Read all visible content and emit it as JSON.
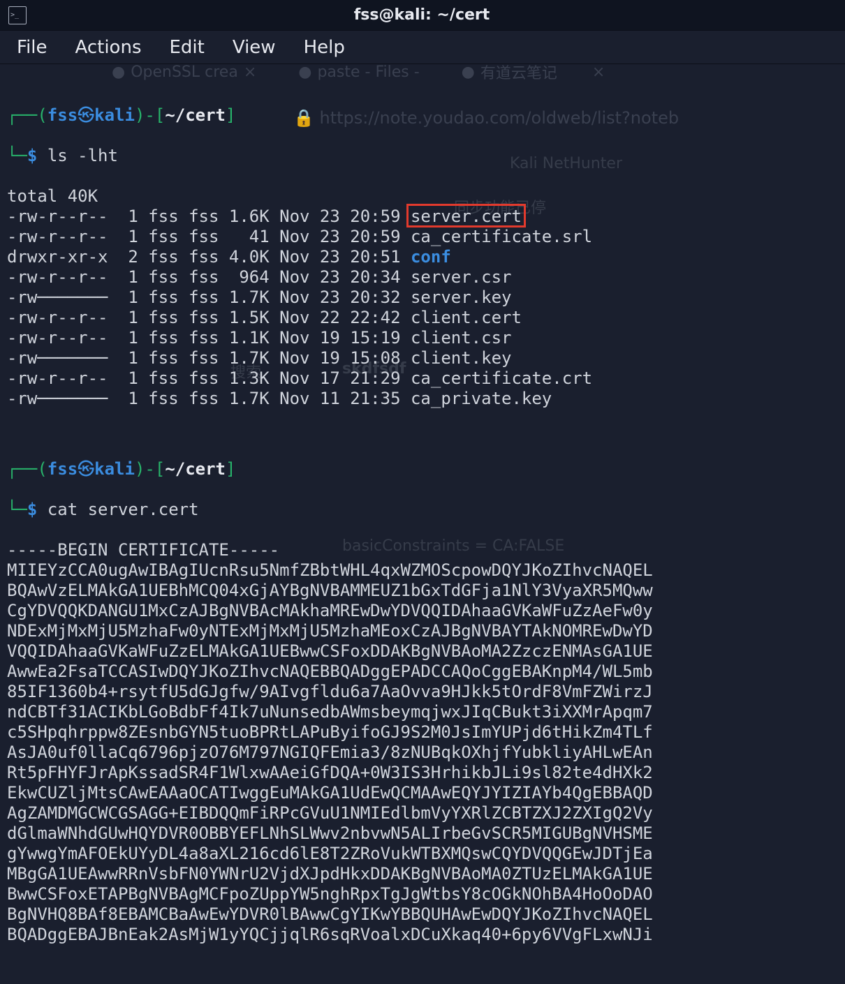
{
  "titlebar": {
    "title": "fss@kali: ~/cert"
  },
  "menubar": {
    "file": "File",
    "actions": "Actions",
    "edit": "Edit",
    "view": "View",
    "help": "Help"
  },
  "ghost": {
    "tab1": "OpenSSL crea",
    "tab2": "paste - Files -",
    "tab3": "有道云笔记",
    "url": "https://note.youdao.com/oldweb/list?noteb",
    "right1": "同步功能已停",
    "search": "搜索",
    "skdf": "skdfsdf",
    "basic": "basicConstraints = CA:FALSE",
    "netHunter": "Kali NetHunter"
  },
  "prompt": {
    "user": "fss",
    "host": "kali",
    "path": "~/cert",
    "cmd1": "ls -lht",
    "cmd2": "cat server.cert"
  },
  "ls": {
    "total": "total 40K",
    "rows": [
      {
        "perm": "-rw-r--r--",
        "ln": "1",
        "u": "fss",
        "g": "fss",
        "sz": "1.6K",
        "dt": "Nov 23 20:59",
        "name": "server.cert",
        "dir": false
      },
      {
        "perm": "-rw-r--r--",
        "ln": "1",
        "u": "fss",
        "g": "fss",
        "sz": "  41",
        "dt": "Nov 23 20:59",
        "name": "ca_certificate.srl",
        "dir": false
      },
      {
        "perm": "drwxr-xr-x",
        "ln": "2",
        "u": "fss",
        "g": "fss",
        "sz": "4.0K",
        "dt": "Nov 23 20:51",
        "name": "conf",
        "dir": true
      },
      {
        "perm": "-rw-r--r--",
        "ln": "1",
        "u": "fss",
        "g": "fss",
        "sz": " 964",
        "dt": "Nov 23 20:34",
        "name": "server.csr",
        "dir": false
      },
      {
        "perm": "-rw-------",
        "ln": "1",
        "u": "fss",
        "g": "fss",
        "sz": "1.7K",
        "dt": "Nov 23 20:32",
        "name": "server.key",
        "dir": false
      },
      {
        "perm": "-rw-r--r--",
        "ln": "1",
        "u": "fss",
        "g": "fss",
        "sz": "1.5K",
        "dt": "Nov 22 22:42",
        "name": "client.cert",
        "dir": false
      },
      {
        "perm": "-rw-r--r--",
        "ln": "1",
        "u": "fss",
        "g": "fss",
        "sz": "1.1K",
        "dt": "Nov 19 15:19",
        "name": "client.csr",
        "dir": false
      },
      {
        "perm": "-rw-------",
        "ln": "1",
        "u": "fss",
        "g": "fss",
        "sz": "1.7K",
        "dt": "Nov 19 15:08",
        "name": "client.key",
        "dir": false
      },
      {
        "perm": "-rw-r--r--",
        "ln": "1",
        "u": "fss",
        "g": "fss",
        "sz": "1.3K",
        "dt": "Nov 17 21:29",
        "name": "ca_certificate.crt",
        "dir": false
      },
      {
        "perm": "-rw-------",
        "ln": "1",
        "u": "fss",
        "g": "fss",
        "sz": "1.7K",
        "dt": "Nov 11 21:35",
        "name": "ca_private.key",
        "dir": false
      }
    ]
  },
  "cert": {
    "begin": "-----BEGIN CERTIFICATE-----",
    "lines": [
      "MIIEYzCCA0ugAwIBAgIUcnRsu5NmfZBbtWHL4qxWZMOScpowDQYJKoZIhvcNAQEL",
      "BQAwVzELMAkGA1UEBhMCQ04xGjAYBgNVBAMMEUZ1bGxTdGFja1NlY3VyaXR5MQww",
      "CgYDVQQKDANGU1MxCzAJBgNVBAcMAkhaMREwDwYDVQQIDAhaaGVKaWFuZzAeFw0y",
      "NDExMjMxMjU5MzhaFw0yNTExMjMxMjU5MzhaMEoxCzAJBgNVBAYTAkNOMREwDwYD",
      "VQQIDAhaaGVKaWFuZzELMAkGA1UEBwwCSFoxDDAKBgNVBAoMA2ZzczENMAsGA1UE",
      "AwwEa2FsaTCCASIwDQYJKoZIhvcNAQEBBQADggEPADCCAQoCggEBAKnpM4/WL5mb",
      "85IF1360b4+rsytfU5dGJgfw/9AIvgfldu6a7AaOvva9HJkk5tOrdF8VmFZWirzJ",
      "ndCBTf31ACIKbLGoBdbFf4Ik7uNunsedbAWmsbeymqjwxJIqCBukt3iXXMrApqm7",
      "c5SHpqhrppw8ZEsnbGYN5tuoBPRtLAPuByifoGJ9S2M0JsImYUPjd6tHikZm4TLf",
      "AsJA0uf0llaCq6796pjzO76M797NGIQFEmia3/8zNUBqkOXhjfYubkliyAHLwEAn",
      "Rt5pFHYFJrApKssadSR4F1WlxwAAeiGfDQA+0W3IS3HrhikbJLi9sl82te4dHXk2",
      "EkwCUZljMtsCAwEAAaOCATIwggEuMAkGA1UdEwQCMAAwEQYJYIZIAYb4QgEBBAQD",
      "AgZAMDMGCWCGSAGG+EIBDQQmFiRPcGVuU1NMIEdlbmVyYXRlZCBTZXJ2ZXIgQ2Vy",
      "dGlmaWNhdGUwHQYDVR0OBBYEFLNhSLWwv2nbvwN5ALIrbeGvSCR5MIGUBgNVHSME",
      "gYwwgYmAFOEkUYyDL4a8aXL216cd6lE8T2ZRoVukWTBXMQswCQYDVQQGEwJDTjEa",
      "MBgGA1UEAwwRRnVsbFN0YWNrU2VjdXJpdHkxDDAKBgNVBAoMA0ZTUzELMAkGA1UE",
      "BwwCSFoxETAPBgNVBAgMCFpoZUppYW5nghRpxTgJgWtbsY8cOGkNOhBA4HoOoDAO",
      "BgNVHQ8BAf8EBAMCBaAwEwYDVR0lBAwwCgYIKwYBBQUHAwEwDQYJKoZIhvcNAQEL",
      "BQADggEBAJBnEak2AsMjW1yYQCjjqlR6sqRVoalxDCuXkaq40+6py6VVgFLxwNJi"
    ]
  },
  "highlight": {
    "target": "server.cert"
  }
}
